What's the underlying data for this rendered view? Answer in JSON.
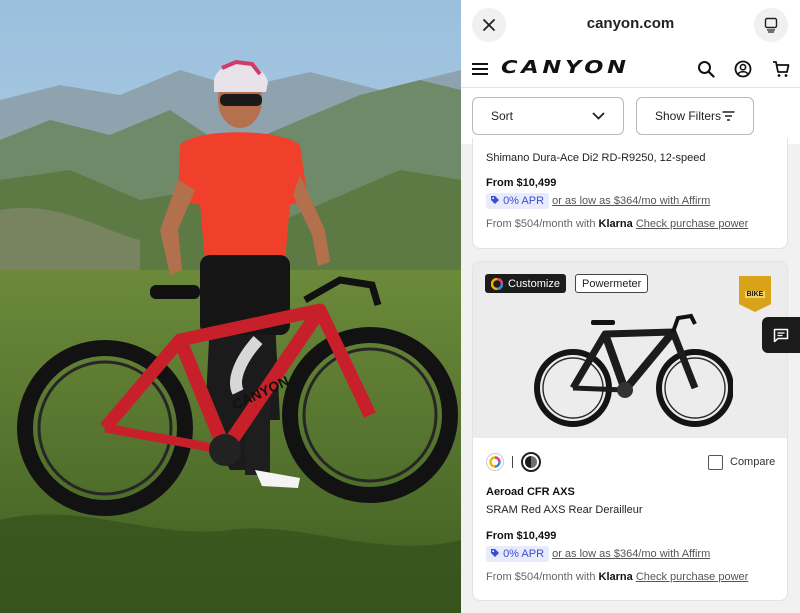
{
  "browser": {
    "url": "canyon.com"
  },
  "site": {
    "brand": "CANYON"
  },
  "filters": {
    "sort_label": "Sort",
    "filters_label": "Show Filters"
  },
  "products": [
    {
      "subtitle": "Shimano Dura-Ace Di2 RD-R9250, 12-speed",
      "price": "From $10,499",
      "apr_label": "0% APR",
      "affirm_text": "or as low as $364/mo with Affirm",
      "klarna_prefix": "From $504/month with",
      "klarna_brand": "Klarna",
      "klarna_link": "Check purchase power"
    },
    {
      "badges": [
        "Customize",
        "Powermeter"
      ],
      "award_badge": "BIKE",
      "compare_label": "Compare",
      "name": "Aeroad CFR AXS",
      "subtitle": "SRAM Red AXS Rear Derailleur",
      "price": "From $10,499",
      "apr_label": "0% APR",
      "affirm_text": "or as low as $364/mo with Affirm",
      "klarna_prefix": "From $504/month with",
      "klarna_brand": "Klarna",
      "klarna_link": "Check purchase power"
    }
  ],
  "colors": {
    "accent_apr_bg": "#e7ebfb",
    "accent_apr_text": "#3a4fd0",
    "jersey_red": "#f0402c",
    "bike_red": "#c8202a"
  },
  "icons": [
    "close-icon",
    "tabs-icon",
    "menu-icon",
    "search-icon",
    "account-icon",
    "cart-icon",
    "chevron-down-icon",
    "filter-icon",
    "tag-icon",
    "chat-icon",
    "color-wheel-icon",
    "color-swatch-icon",
    "checkbox-icon"
  ]
}
